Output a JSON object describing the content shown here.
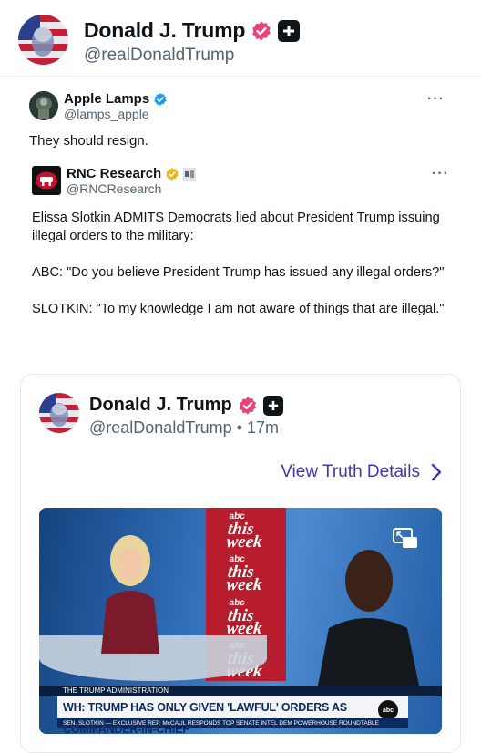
{
  "header": {
    "name": "Donald J. Trump",
    "handle": "@realDonaldTrump"
  },
  "x_post": {
    "name": "Apple Lamps",
    "handle": "@lamps_apple",
    "more": "···",
    "text": "They should resign."
  },
  "quote": {
    "name": "RNC Research",
    "handle": "@RNCResearch",
    "more": "···",
    "paragraphs": [
      "Elissa Slotkin ADMITS Democrats lied about President Trump issuing illegal orders to the military:",
      "ABC: \"Do you believe President Trump has issued any illegal orders?\"",
      "SLOTKIN: \"To my knowledge I am not aware of things that are illegal.\""
    ]
  },
  "card": {
    "name": "Donald J. Trump",
    "handle": "@realDonaldTrump",
    "time": "17m",
    "separator": "•",
    "view_link": "View Truth Details"
  },
  "video": {
    "brand_top": "this",
    "brand_bottom": "week",
    "brand_prefix": "abc",
    "chyron_top": "THE TRUMP ADMINISTRATION",
    "chyron_main": "WH: TRUMP HAS ONLY GIVEN 'LAWFUL' ORDERS AS COMMANDER-IN-CHIEF",
    "chyron_logo": "abc",
    "chyron_bottom": "SEN. SLOTKIN — EXCLUSIVE    REP. McCAUL RESPONDS    TOP SENATE INTEL DEM    POWERHOUSE ROUNDTABLE"
  },
  "colors": {
    "link": "#4336b0",
    "verified_pink": "#e6457a",
    "verified_blue": "#1d9bf0",
    "verified_gold": "#e2b719"
  }
}
